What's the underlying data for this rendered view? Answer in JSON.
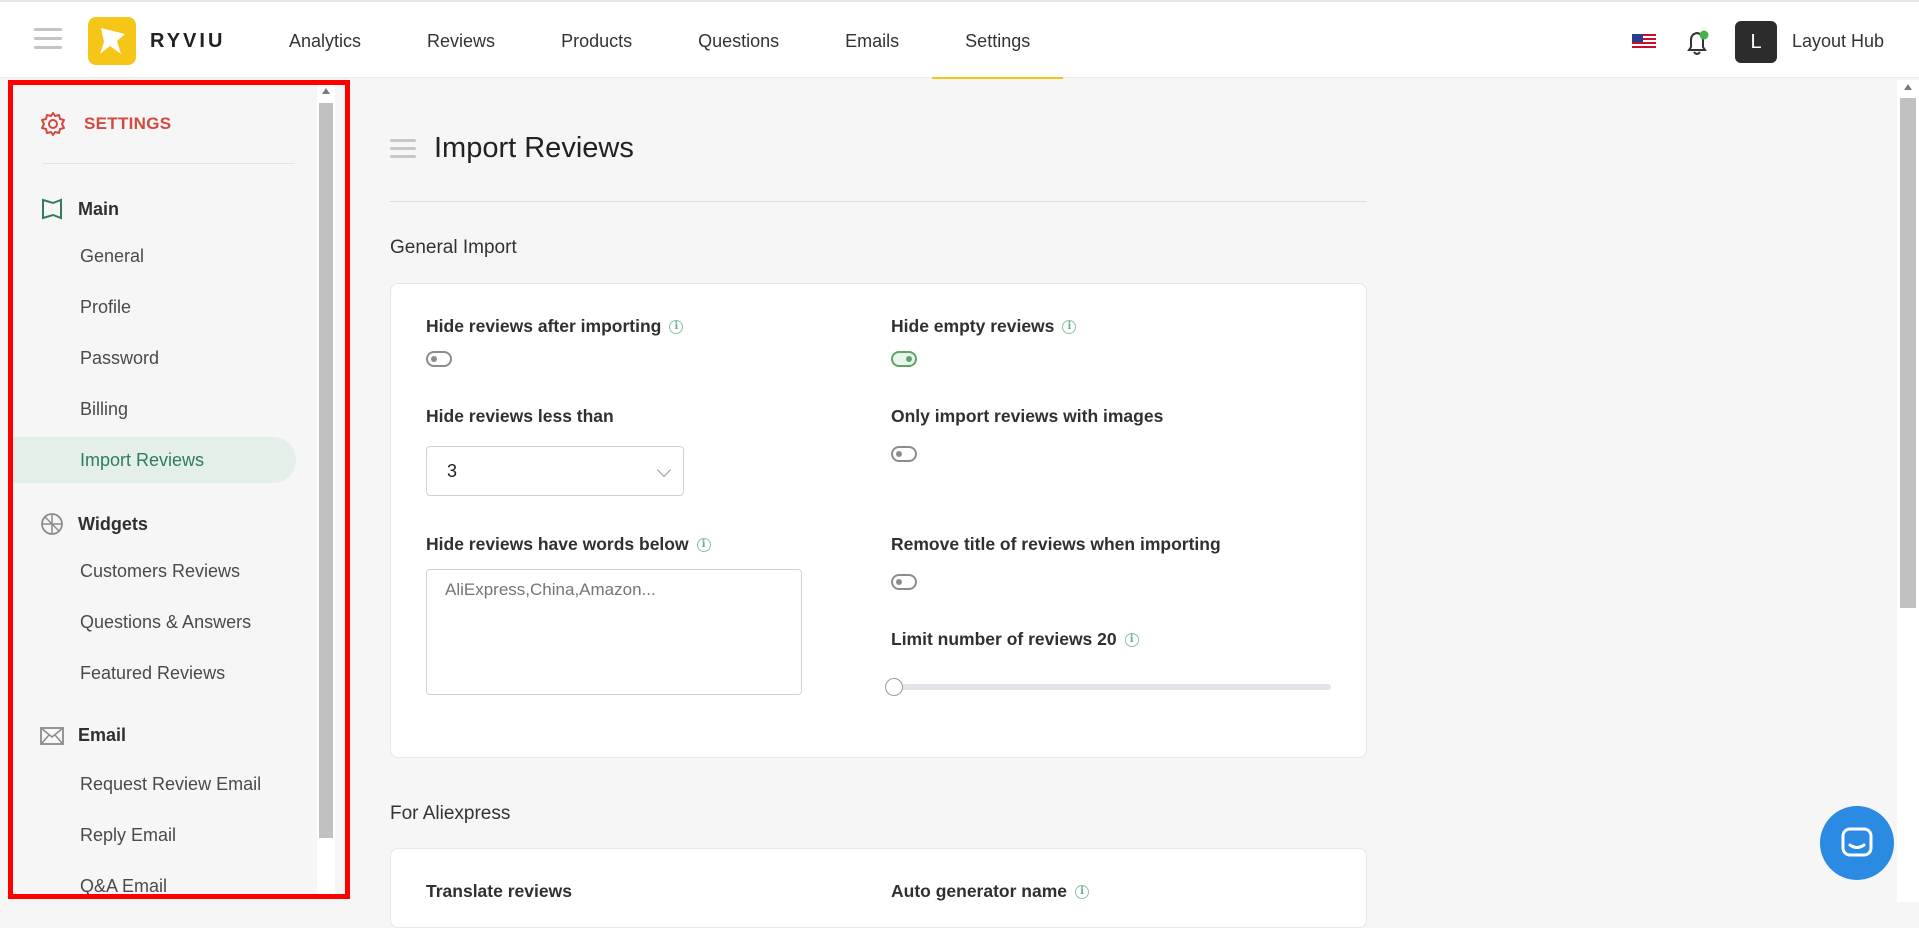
{
  "app": {
    "brand": "RYVIU",
    "store_name": "Layout Hub",
    "avatar_letter": "L"
  },
  "nav": [
    {
      "label": "Analytics",
      "active": false
    },
    {
      "label": "Reviews",
      "active": false
    },
    {
      "label": "Products",
      "active": false
    },
    {
      "label": "Questions",
      "active": false
    },
    {
      "label": "Emails",
      "active": false
    },
    {
      "label": "Settings",
      "active": true
    }
  ],
  "sidebar": {
    "header": "SETTINGS",
    "groups": [
      {
        "label": "Main",
        "items": [
          "General",
          "Profile",
          "Password",
          "Billing",
          "Import Reviews"
        ],
        "active": "Import Reviews"
      },
      {
        "label": "Widgets",
        "items": [
          "Customers Reviews",
          "Questions & Answers",
          "Featured Reviews"
        ]
      },
      {
        "label": "Email",
        "items": [
          "Request Review Email",
          "Reply Email",
          "Q&A Email"
        ]
      }
    ]
  },
  "page": {
    "title": "Import Reviews",
    "general_section": "General Import",
    "fields": {
      "hide_after_import": {
        "label": "Hide reviews after importing",
        "on": false
      },
      "hide_empty": {
        "label": "Hide empty reviews",
        "on": true
      },
      "hide_less_than": {
        "label": "Hide reviews less than",
        "value": "3"
      },
      "only_images": {
        "label": "Only import reviews with images",
        "on": false
      },
      "hide_words": {
        "label": "Hide reviews have words below",
        "placeholder": "AliExpress,China,Amazon..."
      },
      "remove_title": {
        "label": "Remove title of reviews when importing",
        "on": false
      },
      "limit": {
        "label": "Limit number of reviews 20"
      }
    },
    "aliexpress_section": "For Aliexpress",
    "aliexpress_fields": {
      "translate": {
        "label": "Translate reviews"
      },
      "auto_name": {
        "label": "Auto generator name"
      }
    }
  },
  "colors": {
    "accent": "#f5c518",
    "settings_red": "#d2493f",
    "active_green": "#2f7d5b",
    "chat_blue": "#2b8ae2"
  }
}
